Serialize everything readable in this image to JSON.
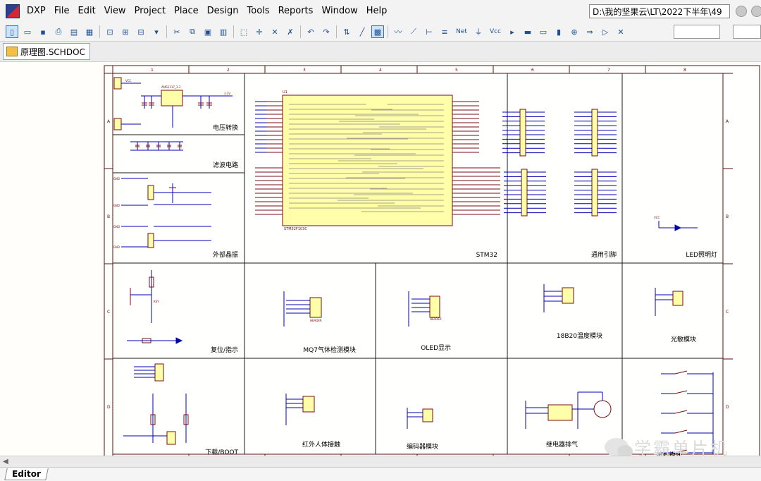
{
  "menubar": {
    "app": "DXP",
    "items": [
      "File",
      "Edit",
      "View",
      "Project",
      "Place",
      "Design",
      "Tools",
      "Reports",
      "Window",
      "Help"
    ],
    "path": "D:\\我的坚果云\\LT\\2022下半年\\49"
  },
  "toolbar": {
    "icons": [
      "new-doc-icon",
      "open-folder-icon",
      "save-icon",
      "print-icon",
      "print-preview-icon",
      "report-icon",
      "zoom-fit-icon",
      "zoom-area-icon",
      "zoom-select-icon",
      "zoom-dropdown-icon",
      "cut-icon",
      "copy-icon",
      "paste-icon",
      "rubber-stamp-icon",
      "select-area-icon",
      "move-icon",
      "deselect-icon",
      "clear-filter-icon",
      "undo-icon",
      "redo-icon",
      "hierarchy-icon",
      "cross-probe-icon",
      "browse-library-icon",
      "wire-icon",
      "bus-icon",
      "bus-entry-icon",
      "net-label-icon",
      "net-label-text-icon",
      "gnd-port-icon",
      "vcc-port-icon",
      "place-part-icon",
      "sheet-symbol-icon",
      "sheet-entry-icon",
      "device-sheet-icon",
      "harness-icon",
      "port-icon",
      "off-sheet-icon",
      "no-erc-icon"
    ],
    "net_text": "Net",
    "vcc_text": "Vcc"
  },
  "document": {
    "tab_label": "原理图.SCHDOC"
  },
  "schematic": {
    "sections": [
      {
        "name": "power",
        "label": "电压转换"
      },
      {
        "name": "filter",
        "label": "滤波电路"
      },
      {
        "name": "crystal",
        "label": "外部晶振"
      },
      {
        "name": "mcu",
        "label": "STM32"
      },
      {
        "name": "gpio",
        "label": "通用引脚"
      },
      {
        "name": "led",
        "label": "LED照明灯"
      },
      {
        "name": "reset",
        "label": "复位/指示"
      },
      {
        "name": "mq7",
        "label": "MQ7气体检测模块"
      },
      {
        "name": "oled",
        "label": "OLED显示"
      },
      {
        "name": "ds18b20",
        "label": "18B20温度模块"
      },
      {
        "name": "light",
        "label": "光敏模块"
      },
      {
        "name": "download",
        "label": "下载/BOOT"
      },
      {
        "name": "pir",
        "label": "红外人体接触"
      },
      {
        "name": "encoder",
        "label": "编码器模块"
      },
      {
        "name": "relay",
        "label": "继电器排气"
      },
      {
        "name": "keys",
        "label": "按键模块"
      }
    ],
    "mcu_label": "U1",
    "mcu_part": "STM32F103C",
    "regulator": "AMS1117_3.3",
    "gnd_text": "GND",
    "vcc_text": "VCC",
    "v33_text": "3.3V",
    "header_text": "HEADER",
    "key_text": "KEY"
  },
  "bottom": {
    "editor_tab": "Editor"
  },
  "watermark": "学霸单片机",
  "colors": {
    "wire": "#0000b4",
    "component": "#7a0b10",
    "part_fill": "#ffffaa",
    "sheet_border": "#5a0f0f",
    "section_border": "#1a1a1a"
  }
}
